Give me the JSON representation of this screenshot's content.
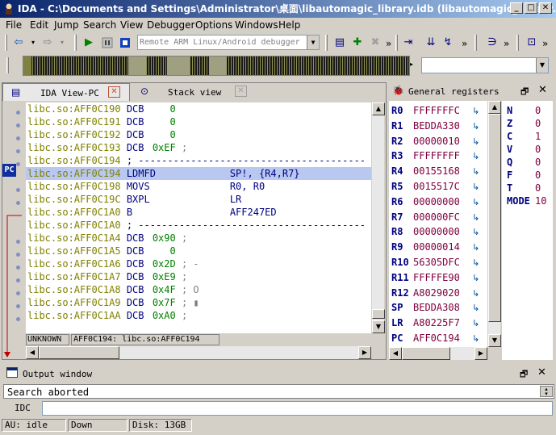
{
  "window": {
    "title": "IDA - C:\\Documents and Settings\\Administrator\\桌面\\libautomagic_library.idb (libautomagic_library.so)"
  },
  "menu": [
    "File",
    "Edit",
    "Jump",
    "Search",
    "View",
    "Debugger",
    "Options",
    "Windows",
    "Help"
  ],
  "toolbar": {
    "debugger_select": "Remote ARM Linux/Android debugger",
    "overflow": "»"
  },
  "ida_view": {
    "tab_label": "IDA View-PC",
    "stack_tab_label": "Stack view",
    "pc_marker": "PC",
    "lines": [
      {
        "addr": "libc.so:AFF0C190",
        "op": "DCB",
        "arg": "   0",
        "kind": "data"
      },
      {
        "addr": "libc.so:AFF0C191",
        "op": "DCB",
        "arg": "   0",
        "kind": "data"
      },
      {
        "addr": "libc.so:AFF0C192",
        "op": "DCB",
        "arg": "   0",
        "kind": "data"
      },
      {
        "addr": "libc.so:AFF0C193",
        "op": "DCB",
        "arg": "0xEF",
        "cmt": " ;",
        "kind": "data"
      },
      {
        "addr": "libc.so:AFF0C194",
        "op": "",
        "arg": "",
        "cmt": " ; ---------------------------------------",
        "kind": "sep"
      },
      {
        "addr": "libc.so:AFF0C194",
        "op": "LDMFD",
        "arg": "SP!, {R4,R7}",
        "kind": "code",
        "highlight": true
      },
      {
        "addr": "libc.so:AFF0C198",
        "op": "MOVS",
        "arg": "R0, R0",
        "kind": "code"
      },
      {
        "addr": "libc.so:AFF0C19C",
        "op": "BXPL",
        "arg": "LR",
        "kind": "code"
      },
      {
        "addr": "libc.so:AFF0C1A0",
        "op": "B",
        "arg": "AFF247ED",
        "kind": "code"
      },
      {
        "addr": "libc.so:AFF0C1A0",
        "op": "",
        "arg": "",
        "cmt": " ; ---------------------------------------",
        "kind": "sep"
      },
      {
        "addr": "libc.so:AFF0C1A4",
        "op": "DCB",
        "arg": "0x90",
        "cmt": " ;",
        "kind": "data"
      },
      {
        "addr": "libc.so:AFF0C1A5",
        "op": "DCB",
        "arg": "   0",
        "kind": "data"
      },
      {
        "addr": "libc.so:AFF0C1A6",
        "op": "DCB",
        "arg": "0x2D",
        "cmt": " ; -",
        "kind": "data"
      },
      {
        "addr": "libc.so:AFF0C1A7",
        "op": "DCB",
        "arg": "0xE9",
        "cmt": " ;",
        "kind": "data"
      },
      {
        "addr": "libc.so:AFF0C1A8",
        "op": "DCB",
        "arg": "0x4F",
        "cmt": " ; O",
        "kind": "data"
      },
      {
        "addr": "libc.so:AFF0C1A9",
        "op": "DCB",
        "arg": "0x7F",
        "cmt": " ; ▮",
        "kind": "data"
      },
      {
        "addr": "libc.so:AFF0C1AA",
        "op": "DCB",
        "arg": "0xA0",
        "cmt": " ;",
        "kind": "data"
      }
    ],
    "status_left": "UNKNOWN",
    "status_right": "AFF0C194: libc.so:AFF0C194"
  },
  "registers": {
    "title": "General registers",
    "list": [
      {
        "name": "R0",
        "value": "FFFFFFFC"
      },
      {
        "name": "R1",
        "value": "BEDDA330"
      },
      {
        "name": "R2",
        "value": "00000010"
      },
      {
        "name": "R3",
        "value": "FFFFFFFF"
      },
      {
        "name": "R4",
        "value": "00155168"
      },
      {
        "name": "R5",
        "value": "0015517C"
      },
      {
        "name": "R6",
        "value": "00000000"
      },
      {
        "name": "R7",
        "value": "000000FC"
      },
      {
        "name": "R8",
        "value": "00000000"
      },
      {
        "name": "R9",
        "value": "00000014"
      },
      {
        "name": "R10",
        "value": "56305DFC"
      },
      {
        "name": "R11",
        "value": "FFFFFE90"
      },
      {
        "name": "R12",
        "value": "A8029020"
      },
      {
        "name": "SP",
        "value": "BEDDA308"
      },
      {
        "name": "LR",
        "value": "A80225F7"
      },
      {
        "name": "PC",
        "value": "AFF0C194"
      }
    ],
    "flags": [
      {
        "name": "N",
        "value": "0"
      },
      {
        "name": "Z",
        "value": "0"
      },
      {
        "name": "C",
        "value": "1"
      },
      {
        "name": "V",
        "value": "0"
      },
      {
        "name": "Q",
        "value": "0"
      },
      {
        "name": "F",
        "value": "0"
      },
      {
        "name": "T",
        "value": "0"
      },
      {
        "name": "MODE",
        "value": "10"
      }
    ]
  },
  "output": {
    "title": "Output window",
    "message": "Search aborted",
    "cmd_label": "IDC"
  },
  "statusbar": {
    "au": "AU:  idle",
    "dir": "Down",
    "disk": "Disk: 13GB"
  }
}
